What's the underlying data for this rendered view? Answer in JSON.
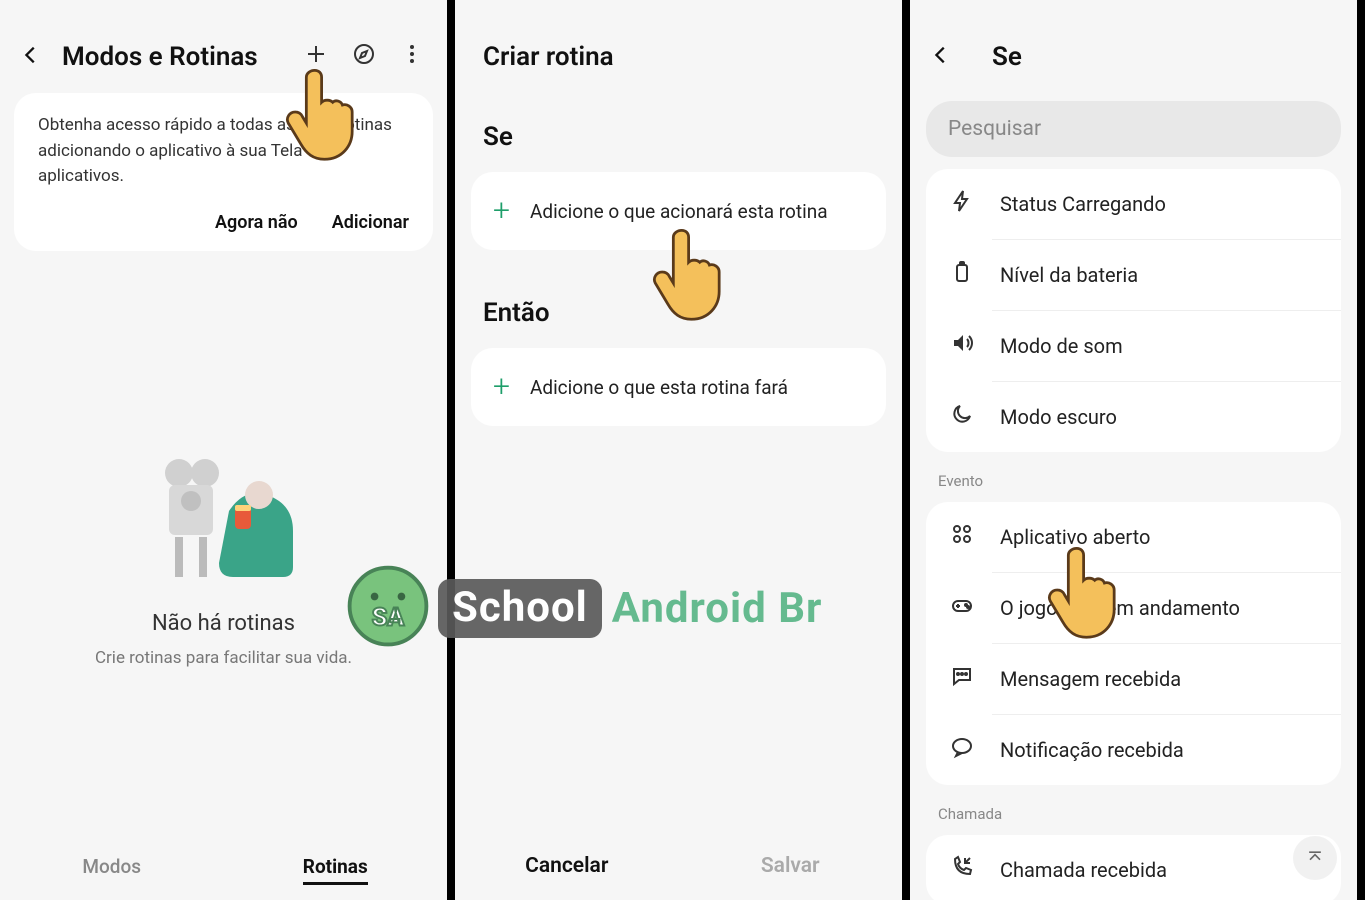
{
  "screen1": {
    "title": "Modos e Rotinas",
    "banner_text": "Obtenha acesso rápido a todas as suas rotinas adicionando o aplicativo à sua Tela de aplicativos.",
    "banner_not_now": "Agora não",
    "banner_add": "Adicionar",
    "empty_title": "Não há rotinas",
    "empty_sub": "Crie rotinas para facilitar sua vida.",
    "tab_modes": "Modos",
    "tab_routines": "Rotinas"
  },
  "screen2": {
    "title": "Criar rotina",
    "if_label": "Se",
    "if_action": "Adicione o que acionará esta rotina",
    "then_label": "Então",
    "then_action": "Adicione o que esta rotina fará",
    "cancel": "Cancelar",
    "save": "Salvar"
  },
  "screen3": {
    "title": "Se",
    "search_placeholder": "Pesquisar",
    "items_group1": [
      "Status Carregando",
      "Nível da bateria",
      "Modo de som",
      "Modo escuro"
    ],
    "group2_label": "Evento",
    "items_group2": [
      "Aplicativo aberto",
      "O jogo está em andamento",
      "Mensagem recebida",
      "Notificação recebida"
    ],
    "group3_label": "Chamada",
    "items_group3": [
      "Chamada recebida"
    ]
  },
  "watermark": {
    "school": "School",
    "android": "Android Br"
  }
}
